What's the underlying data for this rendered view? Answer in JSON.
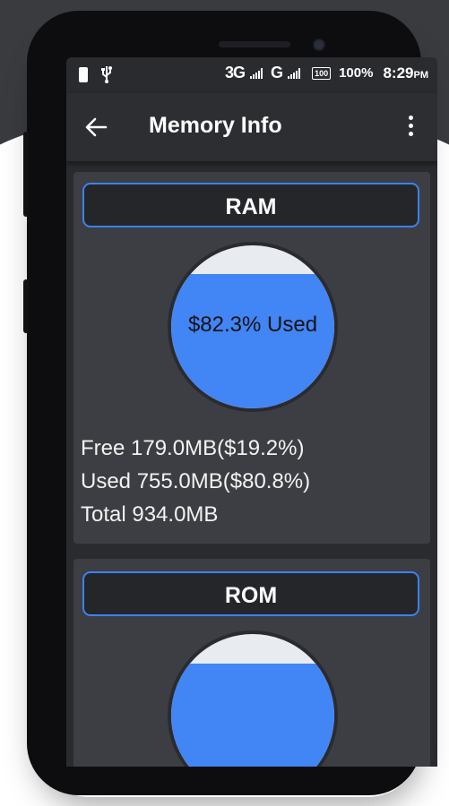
{
  "status_bar": {
    "network_1": "3G",
    "network_2": "G",
    "battery_box": "100",
    "battery_percent": "100%",
    "time": "8:29",
    "time_suffix": "PM"
  },
  "toolbar": {
    "title": "Memory Info",
    "back_icon": "arrow-left-icon",
    "menu_icon": "more-vert-icon"
  },
  "ram": {
    "label": "RAM",
    "gauge_label": "$82.3% Used",
    "used_fraction": 0.823,
    "free": "Free  179.0MB($19.2%)",
    "used": "Used 755.0MB($80.8%)",
    "total": "Total 934.0MB"
  },
  "rom": {
    "label": "ROM",
    "used_fraction": 0.82
  },
  "colors": {
    "accent": "#4285f4",
    "border": "#3b82f0",
    "card": "#3d3e43",
    "screen": "#2a2b2f"
  }
}
